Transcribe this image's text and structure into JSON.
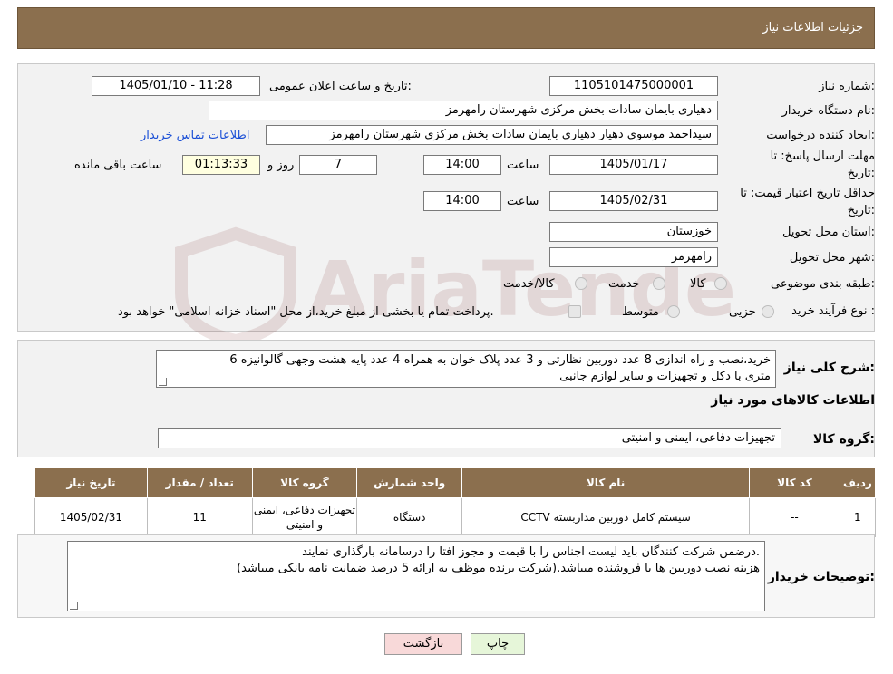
{
  "header": {
    "title": "جزئیات اطلاعات نیاز"
  },
  "info": {
    "need_number_label": "شماره نیاز:",
    "need_number": "1105101475000001",
    "announce_label": "تاریخ و ساعت اعلان عمومی:",
    "announce_value": "1405/01/10 - 11:28",
    "buyer_org_label": "نام دستگاه خریدار:",
    "buyer_org": "دهیاری بایمان سادات بخش مرکزی شهرستان رامهرمز",
    "requester_label": "ایجاد کننده درخواست:",
    "requester": "سیداحمد موسوی دهیار دهیاری بایمان سادات بخش مرکزی شهرستان رامهرمز",
    "contact_link": "اطلاعات تماس خریدار",
    "deadline_label_line1": "مهلت ارسال پاسخ: تا",
    "deadline_label_line2": "تاریخ:",
    "deadline_date": "1405/01/17",
    "time_label": "ساعت",
    "deadline_time": "14:00",
    "days_value": "7",
    "days_label": "روز و",
    "remaining_time": "01:13:33",
    "remaining_label": "ساعت باقی مانده",
    "validity_label_line1": "حداقل تاریخ اعتبار قیمت: تا",
    "validity_label_line2": "تاریخ:",
    "validity_date": "1405/02/31",
    "validity_time_label": "ساعت",
    "validity_time": "14:00",
    "province_label": "استان محل تحویل:",
    "province": "خوزستان",
    "city_label": "شهر محل تحویل:",
    "city": "رامهرمز",
    "category_label": "طبقه بندی موضوعی:",
    "category_options": [
      "کالا",
      "خدمت",
      "کالا/خدمت"
    ],
    "process_label": "نوع فرآیند خرید :",
    "process_options": [
      "جزیی",
      "متوسط"
    ],
    "process_note": "پرداخت تمام یا بخشی از مبلغ خرید،از محل \"اسناد خزانه اسلامی\" خواهد بود."
  },
  "description": {
    "label": "شرح کلی نیاز:",
    "text_line1": "خرید،نصب و راه اندازی 8 عدد دوربین نظارتی و 3 عدد پلاک خوان به همراه 4 عدد پایه هشت وجهی گالوانیزه 6",
    "text_line2": "متری با دکل و تجهیزات و سایر لوازم جانبی",
    "goods_info_title": "اطلاعات کالاهای مورد نیاز",
    "goods_group_label": "گروه کالا:",
    "goods_group": "تجهیزات دفاعی، ایمنی و امنیتی"
  },
  "table": {
    "headers": [
      "ردیف",
      "کد کالا",
      "نام کالا",
      "واحد شمارش",
      "گروه کالا",
      "تعداد / مقدار",
      "تاریخ نیاز"
    ],
    "rows": [
      {
        "row": "1",
        "code": "--",
        "name": "سیستم کامل دوربین مداربسته CCTV",
        "unit": "دستگاه",
        "group": "تجهیزات دفاعی، ایمنی و امنیتی",
        "qty": "11",
        "date": "1405/02/31"
      }
    ]
  },
  "buyer_notes": {
    "label": "توضیحات خریدار:",
    "line1": "درضمن شرکت کنندگان باید لیست اجناس را با قیمت و مجوز افتا را درسامانه بارگذاری نمایند.",
    "line2": "هزینه نصب دوربین ها با فروشنده میباشد.(شرکت برنده موظف به ارائه 5 درصد ضمانت نامه بانکی میباشد)"
  },
  "buttons": {
    "print": "چاپ",
    "back": "بازگشت"
  },
  "watermark": {
    "text": "AriaTender.neT"
  },
  "colors": {
    "header": "#8b6f4e",
    "panel": "#f2f2f2",
    "link": "#1a4fd6",
    "back_button": "#f8d9d9",
    "print_button": "#e6f6d9"
  }
}
